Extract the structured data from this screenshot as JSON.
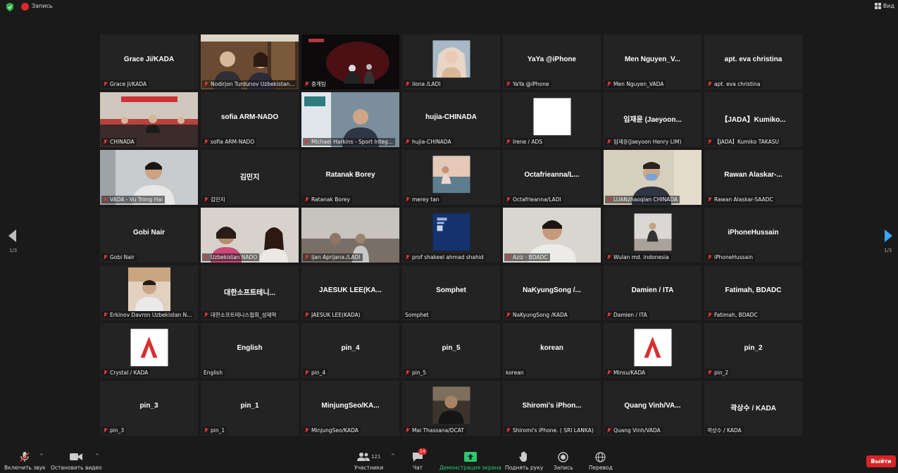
{
  "window": {
    "record_label": "Запись",
    "view_label": "Вид"
  },
  "page_indicator": "1/3",
  "tiles": [
    {
      "big": "Grace Ji/KADA",
      "name": "Grace Ji/KADA",
      "video": "none"
    },
    {
      "big": "",
      "name": "Nodirjon Turdunov Uzbekistan...",
      "video": "room"
    },
    {
      "big": "",
      "name": "중계팀",
      "video": "stage",
      "speaker": true
    },
    {
      "big": "",
      "name": "ilona /LADI",
      "video": "avatar-portrait"
    },
    {
      "big": "YaYa @iPhone",
      "name": "YaYa @iPhone",
      "video": "none"
    },
    {
      "big": "Men Nguyen_V...",
      "name": "Men Nguyen_VADA",
      "video": "none"
    },
    {
      "big": "apt. eva christina",
      "name": "apt. eva christina",
      "video": "none"
    },
    {
      "big": "",
      "name": "CHINADA",
      "video": "meeting"
    },
    {
      "big": "sofia ARM-NADO",
      "name": "sofia ARM-NADO",
      "video": "none"
    },
    {
      "big": "",
      "name": "Michael Harkins - Sport Integ...",
      "video": "office"
    },
    {
      "big": "hujia-CHINADA",
      "name": "hujia-CHINADA",
      "video": "none"
    },
    {
      "big": "",
      "name": "Irene / ADS",
      "video": "white-square"
    },
    {
      "big": "임재윤 (Jaeyoon...",
      "name": "임재윤(Jaeyoon Henry LIM)",
      "video": "none"
    },
    {
      "big": "【JADA】Kumiko...",
      "name": "【JADA】Kumiko TAKASU",
      "video": "none"
    },
    {
      "big": "",
      "name": "VADA - Vu Trong Hai",
      "video": "person-light"
    },
    {
      "big": "김민지",
      "name": "김민지",
      "video": "none"
    },
    {
      "big": "Ratanak Borey",
      "name": "Ratanak Borey",
      "video": "none"
    },
    {
      "big": "",
      "name": "merey tan",
      "video": "avatar-sunset"
    },
    {
      "big": "Octafrieanna/L...",
      "name": "Octafrieanna/LADI",
      "video": "none"
    },
    {
      "big": "",
      "name": "LUANzhaoqian CHINADA",
      "video": "person-mask"
    },
    {
      "big": "Rawan Alaskar-...",
      "name": "Rawan Alaskar-SAADC",
      "video": "none"
    },
    {
      "big": "Gobi Nair",
      "name": "Gobi Nair",
      "video": "none"
    },
    {
      "big": "",
      "name": "Uzbekistan NADO",
      "video": "two-women"
    },
    {
      "big": "",
      "name": "Ijan Aprijana./LADI",
      "video": "blurry"
    },
    {
      "big": "",
      "name": "prof shakeel ahmad shahid",
      "video": "avatar-blue"
    },
    {
      "big": "",
      "name": "Aziz - BDADC",
      "video": "person-young"
    },
    {
      "big": "",
      "name": "Wulan md. indonesia",
      "video": "avatar-room"
    },
    {
      "big": "iPhoneHussain",
      "name": "iPhoneHussain",
      "video": "none"
    },
    {
      "big": "",
      "name": "Erkinov Davron Uzbekistan N...",
      "video": "avatar-man"
    },
    {
      "big": "대한소프트테니...",
      "name": "대한소프트테니스협회_성재혁",
      "video": "none"
    },
    {
      "big": "JAESUK LEE(KA...",
      "name": "JAESUK LEE(KADA)",
      "video": "none"
    },
    {
      "big": "Somphet",
      "name": "Somphet",
      "video": "none",
      "nomic": true
    },
    {
      "big": "NaKyungSong /...",
      "name": "NaKyungSong /KADA",
      "video": "none"
    },
    {
      "big": "Damien / ITA",
      "name": "Damien / ITA",
      "video": "none"
    },
    {
      "big": "Fatimah, BDADC",
      "name": "Fatimah, BDADC",
      "video": "none"
    },
    {
      "big": "",
      "name": "Crystal / KADA",
      "video": "logo-a"
    },
    {
      "big": "English",
      "name": "English",
      "video": "none",
      "nomic": true
    },
    {
      "big": "pin_4",
      "name": "pin_4",
      "video": "none"
    },
    {
      "big": "pin_5",
      "name": "pin_5",
      "video": "none"
    },
    {
      "big": "korean",
      "name": "korean",
      "video": "none",
      "nomic": true
    },
    {
      "big": "",
      "name": "Minsu/KADA",
      "video": "logo-a"
    },
    {
      "big": "pin_2",
      "name": "pin_2",
      "video": "none"
    },
    {
      "big": "pin_3",
      "name": "pin_3",
      "video": "none"
    },
    {
      "big": "pin_1",
      "name": "pin_1",
      "video": "none"
    },
    {
      "big": "MinjungSeo/KA...",
      "name": "MinjungSeo/KADA",
      "video": "none"
    },
    {
      "big": "",
      "name": "Mai Thassana/DCAT",
      "video": "avatar-dark"
    },
    {
      "big": "Shiromi's iPhon...",
      "name": "Shiromi's iPhone. ( SRI LANKA)",
      "video": "none"
    },
    {
      "big": "Quang Vinh/VA...",
      "name": "Quang Vinh/VADA",
      "video": "none"
    },
    {
      "big": "곽상수 / KADA",
      "name": "곽상수 / KADA",
      "video": "none",
      "nomic": true
    }
  ],
  "toolbar": {
    "unmute": "Включить звук",
    "stop_video": "Остановить видео",
    "participants": "Участники",
    "participants_count": "121",
    "chat": "Чат",
    "chat_badge": "14",
    "share": "Демонстрация экрана",
    "raise_hand": "Поднять руку",
    "record": "Запись",
    "translate": "Перевод",
    "leave": "Выйти"
  }
}
